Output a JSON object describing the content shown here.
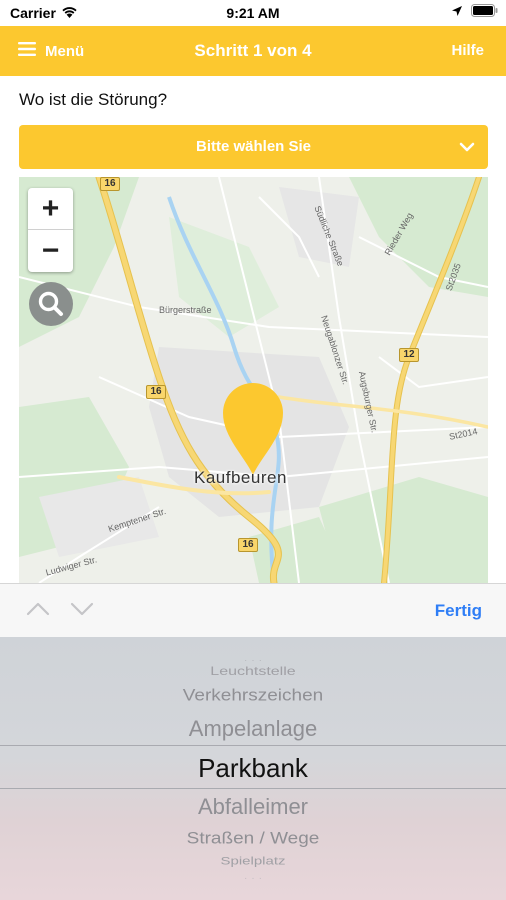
{
  "status_bar": {
    "carrier": "Carrier",
    "time": "9:21 AM"
  },
  "nav": {
    "menu_label": "Menü",
    "title": "Schritt 1 von 4",
    "help_label": "Hilfe"
  },
  "question": "Wo ist die Störung?",
  "select": {
    "label": "Bitte wählen Sie"
  },
  "map": {
    "city": "Kaufbeuren",
    "zoom_in": "+",
    "zoom_out": "−",
    "road_labels": [
      "Bürgerstraße",
      "Südliche Straße",
      "Augsburger Str.",
      "Kemptener Str.",
      "Ludwiger Str.",
      "Neugablonzer Str.",
      "St2035",
      "St2014",
      "Rieder Weg"
    ],
    "road_shields": [
      "16",
      "16",
      "16",
      "12"
    ],
    "colors": {
      "land": "#eef0ea",
      "green": "#d6ead1",
      "major_road": "#f7d774",
      "water": "#a9d3f2",
      "marker": "#fcc82f"
    }
  },
  "toolbar": {
    "done_label": "Fertig"
  },
  "picker": {
    "items": [
      "Leuchtstelle",
      "Verkehrszeichen",
      "Ampelanlage",
      "Parkbank",
      "Abfalleimer",
      "Straßen / Wege",
      "Spielplatz"
    ],
    "selected": "Parkbank"
  },
  "colors": {
    "accent": "#fcc82f",
    "link": "#2f7ef6"
  }
}
